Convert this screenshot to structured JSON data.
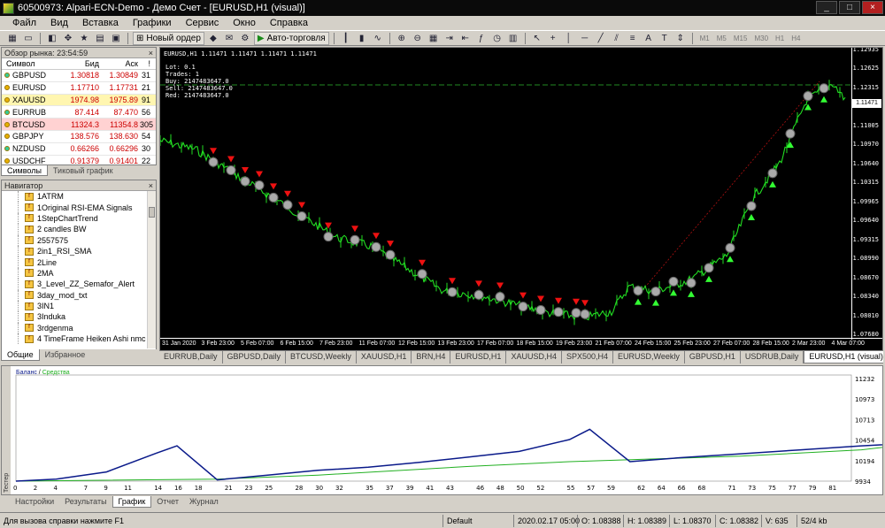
{
  "window": {
    "title": "60500973: Alpari-ECN-Demo - Демо Счет - [EURUSD,H1 (visual)]",
    "controls": [
      "_",
      "□",
      "×"
    ]
  },
  "menu": [
    "Файл",
    "Вид",
    "Вставка",
    "Графики",
    "Сервис",
    "Окно",
    "Справка"
  ],
  "toolbar": {
    "new_order": "Новый ордер",
    "auto_trading": "Авто-торговля",
    "timeframes": [
      "M1",
      "M5",
      "M15",
      "M30",
      "H1",
      "H4"
    ]
  },
  "market_watch": {
    "header": "Обзор рынка: 23:54:59",
    "columns": [
      "Символ",
      "Бид",
      "Аск",
      "!"
    ],
    "rows": [
      {
        "symbol": "GBPUSD",
        "bid": "1.30818",
        "ask": "1.30849",
        "spread": "31",
        "style": ""
      },
      {
        "symbol": "EURUSD",
        "bid": "1.17710",
        "ask": "1.17731",
        "spread": "21",
        "style": ""
      },
      {
        "symbol": "XAUUSD",
        "bid": "1974.98",
        "ask": "1975.89",
        "spread": "91",
        "style": "yellow"
      },
      {
        "symbol": "EURRUB",
        "bid": "87.414",
        "ask": "87.470",
        "spread": "56",
        "style": ""
      },
      {
        "symbol": "BTCUSD",
        "bid": "11324.3",
        "ask": "11354.8",
        "spread": "305",
        "style": "pink"
      },
      {
        "symbol": "GBPJPY",
        "bid": "138.576",
        "ask": "138.630",
        "spread": "54",
        "style": ""
      },
      {
        "symbol": "NZDUSD",
        "bid": "0.66266",
        "ask": "0.66296",
        "spread": "30",
        "style": ""
      },
      {
        "symbol": "USDCHF",
        "bid": "0.91379",
        "ask": "0.91401",
        "spread": "22",
        "style": ""
      }
    ],
    "tabs": [
      "Символы",
      "Тиковый график"
    ]
  },
  "navigator": {
    "header": "Навигатор",
    "items": [
      "1ATRM",
      "1Original RSI-EMA Signals",
      "1StepChartTrend",
      "2 candles  BW",
      "2557575",
      "2in1_RSI_SMA",
      "2Line",
      "2MA",
      "3_Level_ZZ_Semafor_Alert",
      "3day_mod_txt",
      "3IN1",
      "3Induka",
      "3rdgenma",
      "4 TimeFrame Heiken Ashi nmc"
    ],
    "tabs": [
      "Общие",
      "Избранное"
    ]
  },
  "chart": {
    "symbol_line": "EURUSD,H1  1.11471 1.11471 1.11471 1.11471",
    "info": [
      "Lot: 0.1",
      "Trades: 1",
      "Buy: 2147483647.0",
      "Sell: 2147483647.0",
      "Red: 2147483647.0"
    ],
    "price_ticks": [
      "1.12935",
      "1.12625",
      "1.12315",
      "1.11471",
      "1.11005",
      "1.10970",
      "1.10640",
      "1.10315",
      "1.09965",
      "1.09640",
      "1.09315",
      "1.08990",
      "1.08670",
      "1.08340",
      "1.08010",
      "1.07680"
    ],
    "current_price": "1.11471",
    "time_ticks": [
      "31 Jan 2020",
      "3 Feb 23:00",
      "5 Feb 07:00",
      "6 Feb 15:00",
      "7 Feb 23:00",
      "11 Feb 07:00",
      "12 Feb 15:00",
      "13 Feb 23:00",
      "17 Feb 07:00",
      "18 Feb 15:00",
      "19 Feb 23:00",
      "21 Feb 07:00",
      "24 Feb 15:00",
      "25 Feb 23:00",
      "27 Feb 07:00",
      "28 Feb 15:00",
      "2 Mar 23:00",
      "4 Mar 07:00"
    ]
  },
  "chart_tabs": [
    "EURRUB,Daily",
    "GBPUSD,Daily",
    "BTCUSD,Weekly",
    "XAUUSD,H1",
    "BRN,H4",
    "EURUSD,H1",
    "XAUUSD,H4",
    "SPX500,H4",
    "EURUSD,Weekly",
    "GBPUSD,H1",
    "USDRUB,Daily",
    "EURUSD,H1 (visual)"
  ],
  "tester": {
    "side_label": "Тестер",
    "legend_balance": "Баланс",
    "legend_sep": " / ",
    "legend_equity": "Средства",
    "y_ticks": [
      "11232",
      "10973",
      "10713",
      "10454",
      "10194",
      "9934"
    ],
    "x_ticks": [
      "0",
      "2",
      "4",
      "7",
      "9",
      "11",
      "14",
      "16",
      "18",
      "21",
      "23",
      "25",
      "28",
      "30",
      "32",
      "35",
      "37",
      "39",
      "41",
      "43",
      "46",
      "48",
      "50",
      "52",
      "55",
      "57",
      "59",
      "62",
      "64",
      "66",
      "68",
      "71",
      "73",
      "75",
      "77",
      "79",
      "81"
    ],
    "tabs": [
      "Настройки",
      "Результаты",
      "График",
      "Отчет",
      "Журнал"
    ],
    "balance_color": "#0a1a8a",
    "equity_color": "#21b021"
  },
  "status": {
    "help": "Для вызова справки нажмите F1",
    "profile": "Default",
    "date": "2020.02.17 05:00",
    "o": "O: 1.08388",
    "h": "H: 1.08389",
    "l": "L: 1.08370",
    "c": "C: 1.08382",
    "v": "V: 635",
    "traffic": "52/4 kb"
  }
}
